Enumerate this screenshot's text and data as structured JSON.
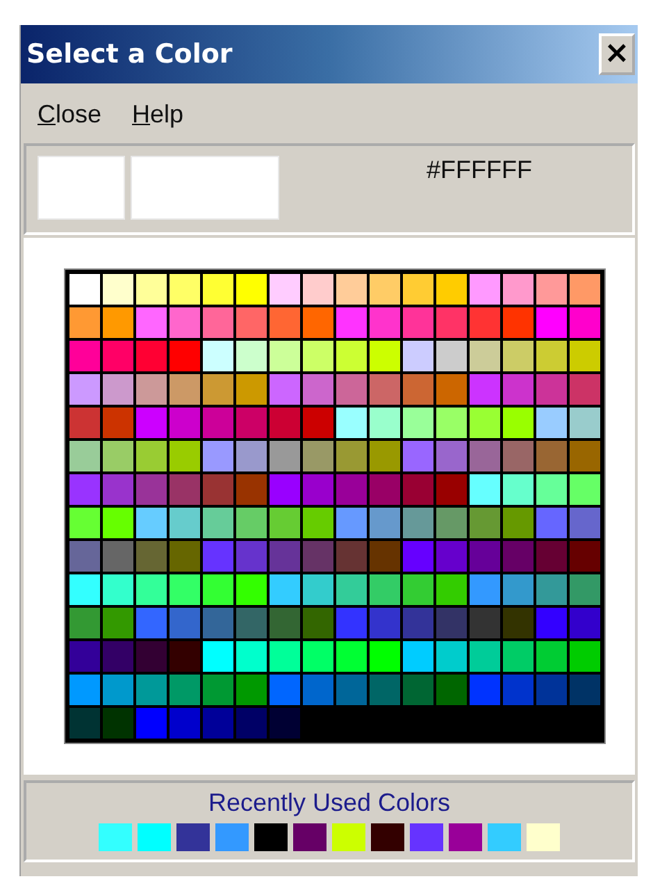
{
  "window": {
    "title": "Select a Color",
    "close_button": "×"
  },
  "menu": [
    {
      "mnemonic": "C",
      "rest": "lose"
    },
    {
      "mnemonic": "H",
      "rest": "elp"
    }
  ],
  "preview": {
    "swatches": [
      {
        "color": "#ffffff"
      },
      {
        "color": "#ffffff"
      }
    ],
    "hex": "#FFFFFF"
  },
  "palette": [
    [
      {
        "color": "#ffffff"
      },
      {
        "color": "#ffffcc"
      },
      {
        "color": "#ffff99"
      },
      {
        "color": "#ffff66"
      },
      {
        "color": "#ffff33"
      },
      {
        "color": "#ffff00"
      },
      {
        "color": "#ffccff"
      },
      {
        "color": "#ffcccc"
      },
      {
        "color": "#ffcc99"
      },
      {
        "color": "#ffcc66"
      },
      {
        "color": "#ffcc33"
      },
      {
        "color": "#ffcc00"
      },
      {
        "color": "#ff99ff"
      },
      {
        "color": "#ff99cc"
      },
      {
        "color": "#ff9999"
      },
      {
        "color": "#ff9966"
      }
    ],
    [
      {
        "color": "#ff9933"
      },
      {
        "color": "#ff9900"
      },
      {
        "color": "#ff66ff"
      },
      {
        "color": "#ff66cc"
      },
      {
        "color": "#ff6699"
      },
      {
        "color": "#ff6666"
      },
      {
        "color": "#ff6633"
      },
      {
        "color": "#ff6600"
      },
      {
        "color": "#ff33ff"
      },
      {
        "color": "#ff33cc"
      },
      {
        "color": "#ff3399"
      },
      {
        "color": "#ff3366"
      },
      {
        "color": "#ff3333"
      },
      {
        "color": "#ff3300"
      },
      {
        "color": "#ff00ff"
      },
      {
        "color": "#ff00cc"
      }
    ],
    [
      {
        "color": "#ff0099"
      },
      {
        "color": "#ff0066"
      },
      {
        "color": "#ff0033"
      },
      {
        "color": "#ff0000"
      },
      {
        "color": "#ccffff"
      },
      {
        "color": "#ccffcc"
      },
      {
        "color": "#ccff99"
      },
      {
        "color": "#ccff66"
      },
      {
        "color": "#ccff33"
      },
      {
        "color": "#ccff00"
      },
      {
        "color": "#ccccff"
      },
      {
        "color": "#cccccc"
      },
      {
        "color": "#cccc99"
      },
      {
        "color": "#cccc66"
      },
      {
        "color": "#cccc33"
      },
      {
        "color": "#cccc00"
      }
    ],
    [
      {
        "color": "#cc99ff"
      },
      {
        "color": "#cc99cc"
      },
      {
        "color": "#cc9999"
      },
      {
        "color": "#cc9966"
      },
      {
        "color": "#cc9933"
      },
      {
        "color": "#cc9900"
      },
      {
        "color": "#cc66ff"
      },
      {
        "color": "#cc66cc"
      },
      {
        "color": "#cc6699"
      },
      {
        "color": "#cc6666"
      },
      {
        "color": "#cc6633"
      },
      {
        "color": "#cc6600"
      },
      {
        "color": "#cc33ff"
      },
      {
        "color": "#cc33cc"
      },
      {
        "color": "#cc3399"
      },
      {
        "color": "#cc3366"
      }
    ],
    [
      {
        "color": "#cc3333"
      },
      {
        "color": "#cc3300"
      },
      {
        "color": "#cc00ff"
      },
      {
        "color": "#cc00cc"
      },
      {
        "color": "#cc0099"
      },
      {
        "color": "#cc0066"
      },
      {
        "color": "#cc0033"
      },
      {
        "color": "#cc0000"
      },
      {
        "color": "#99ffff"
      },
      {
        "color": "#99ffcc"
      },
      {
        "color": "#99ff99"
      },
      {
        "color": "#99ff66"
      },
      {
        "color": "#99ff33"
      },
      {
        "color": "#99ff00"
      },
      {
        "color": "#99ccff"
      },
      {
        "color": "#99cccc"
      }
    ],
    [
      {
        "color": "#99cc99"
      },
      {
        "color": "#99cc66"
      },
      {
        "color": "#99cc33"
      },
      {
        "color": "#99cc00"
      },
      {
        "color": "#9999ff"
      },
      {
        "color": "#9999cc"
      },
      {
        "color": "#999999"
      },
      {
        "color": "#999966"
      },
      {
        "color": "#999933"
      },
      {
        "color": "#999900"
      },
      {
        "color": "#9966ff"
      },
      {
        "color": "#9966cc"
      },
      {
        "color": "#996699"
      },
      {
        "color": "#996666"
      },
      {
        "color": "#996633"
      },
      {
        "color": "#996600"
      }
    ],
    [
      {
        "color": "#9933ff"
      },
      {
        "color": "#9933cc"
      },
      {
        "color": "#993399"
      },
      {
        "color": "#993366"
      },
      {
        "color": "#993333"
      },
      {
        "color": "#993300"
      },
      {
        "color": "#9900ff"
      },
      {
        "color": "#9900cc"
      },
      {
        "color": "#990099"
      },
      {
        "color": "#990066"
      },
      {
        "color": "#990033"
      },
      {
        "color": "#990000"
      },
      {
        "color": "#66ffff"
      },
      {
        "color": "#66ffcc"
      },
      {
        "color": "#66ff99"
      },
      {
        "color": "#66ff66"
      }
    ],
    [
      {
        "color": "#66ff33"
      },
      {
        "color": "#66ff00"
      },
      {
        "color": "#66ccff"
      },
      {
        "color": "#66cccc"
      },
      {
        "color": "#66cc99"
      },
      {
        "color": "#66cc66"
      },
      {
        "color": "#66cc33"
      },
      {
        "color": "#66cc00"
      },
      {
        "color": "#6699ff"
      },
      {
        "color": "#6699cc"
      },
      {
        "color": "#669999"
      },
      {
        "color": "#669966"
      },
      {
        "color": "#669933"
      },
      {
        "color": "#669900"
      },
      {
        "color": "#6666ff"
      },
      {
        "color": "#6666cc"
      }
    ],
    [
      {
        "color": "#666699"
      },
      {
        "color": "#666666"
      },
      {
        "color": "#666633"
      },
      {
        "color": "#666600"
      },
      {
        "color": "#6633ff"
      },
      {
        "color": "#6633cc"
      },
      {
        "color": "#663399"
      },
      {
        "color": "#663366"
      },
      {
        "color": "#663333"
      },
      {
        "color": "#663300"
      },
      {
        "color": "#6600ff"
      },
      {
        "color": "#6600cc"
      },
      {
        "color": "#660099"
      },
      {
        "color": "#660066"
      },
      {
        "color": "#660033"
      },
      {
        "color": "#660000"
      }
    ],
    [
      {
        "color": "#33ffff"
      },
      {
        "color": "#33ffcc"
      },
      {
        "color": "#33ff99"
      },
      {
        "color": "#33ff66"
      },
      {
        "color": "#33ff33"
      },
      {
        "color": "#33ff00"
      },
      {
        "color": "#33ccff"
      },
      {
        "color": "#33cccc"
      },
      {
        "color": "#33cc99"
      },
      {
        "color": "#33cc66"
      },
      {
        "color": "#33cc33"
      },
      {
        "color": "#33cc00"
      },
      {
        "color": "#3399ff"
      },
      {
        "color": "#3399cc"
      },
      {
        "color": "#339999"
      },
      {
        "color": "#339966"
      }
    ],
    [
      {
        "color": "#339933"
      },
      {
        "color": "#339900"
      },
      {
        "color": "#3366ff"
      },
      {
        "color": "#3366cc"
      },
      {
        "color": "#336699"
      },
      {
        "color": "#336666"
      },
      {
        "color": "#336633"
      },
      {
        "color": "#336600"
      },
      {
        "color": "#3333ff"
      },
      {
        "color": "#3333cc"
      },
      {
        "color": "#333399"
      },
      {
        "color": "#333366"
      },
      {
        "color": "#333333"
      },
      {
        "color": "#333300"
      },
      {
        "color": "#3300ff"
      },
      {
        "color": "#3300cc"
      }
    ],
    [
      {
        "color": "#330099"
      },
      {
        "color": "#330066"
      },
      {
        "color": "#330033"
      },
      {
        "color": "#330000"
      },
      {
        "color": "#00ffff"
      },
      {
        "color": "#00ffcc"
      },
      {
        "color": "#00ff99"
      },
      {
        "color": "#00ff66"
      },
      {
        "color": "#00ff33"
      },
      {
        "color": "#00ff00"
      },
      {
        "color": "#00ccff"
      },
      {
        "color": "#00cccc"
      },
      {
        "color": "#00cc99"
      },
      {
        "color": "#00cc66"
      },
      {
        "color": "#00cc33"
      },
      {
        "color": "#00cc00"
      }
    ],
    [
      {
        "color": "#0099ff"
      },
      {
        "color": "#0099cc"
      },
      {
        "color": "#009999"
      },
      {
        "color": "#009966"
      },
      {
        "color": "#009933"
      },
      {
        "color": "#009900"
      },
      {
        "color": "#0066ff"
      },
      {
        "color": "#0066cc"
      },
      {
        "color": "#006699"
      },
      {
        "color": "#006666"
      },
      {
        "color": "#006633"
      },
      {
        "color": "#006600"
      },
      {
        "color": "#0033ff"
      },
      {
        "color": "#0033cc"
      },
      {
        "color": "#003399"
      },
      {
        "color": "#003366"
      }
    ],
    [
      {
        "color": "#003333"
      },
      {
        "color": "#003300"
      },
      {
        "color": "#0000ff"
      },
      {
        "color": "#0000cc"
      },
      {
        "color": "#000099"
      },
      {
        "color": "#000066"
      },
      {
        "color": "#000033"
      }
    ]
  ],
  "recent": {
    "title": "Recently Used Colors",
    "colors": [
      {
        "color": "#33ffff"
      },
      {
        "color": "#00ffff"
      },
      {
        "color": "#333399"
      },
      {
        "color": "#3399ff"
      },
      {
        "color": "#000000"
      },
      {
        "color": "#660066"
      },
      {
        "color": "#ccff00"
      },
      {
        "color": "#330000"
      },
      {
        "color": "#6633ff"
      },
      {
        "color": "#990099"
      },
      {
        "color": "#33ccff"
      },
      {
        "color": "#ffffcc"
      }
    ]
  }
}
